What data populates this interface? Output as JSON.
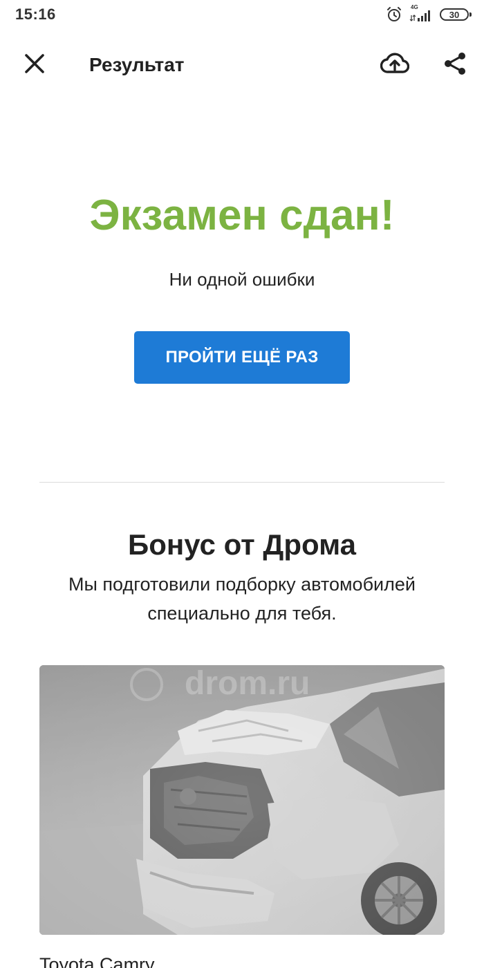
{
  "status_bar": {
    "time": "15:16",
    "network_label": "4G",
    "battery_level": "30",
    "icons": [
      "alarm-icon",
      "signal-icon",
      "battery-icon"
    ]
  },
  "app_bar": {
    "title": "Результат",
    "icons": [
      "close-icon",
      "cloud-upload-icon",
      "share-icon"
    ]
  },
  "result": {
    "title": "Экзамен сдан!",
    "subtitle": "Ни одной ошибки",
    "retry_label": "ПРОЙТИ ЕЩЁ РАЗ"
  },
  "bonus": {
    "title": "Бонус от Дрома",
    "text": "Мы подготовили подборку автомобилей специально для тебя."
  },
  "cars": [
    {
      "name": "Toyota Camry",
      "watermark": "drom.ru"
    }
  ],
  "colors": {
    "success": "#7cb342",
    "primary": "#1e7bd6",
    "text": "#222222",
    "divider": "#dcdcdc"
  }
}
